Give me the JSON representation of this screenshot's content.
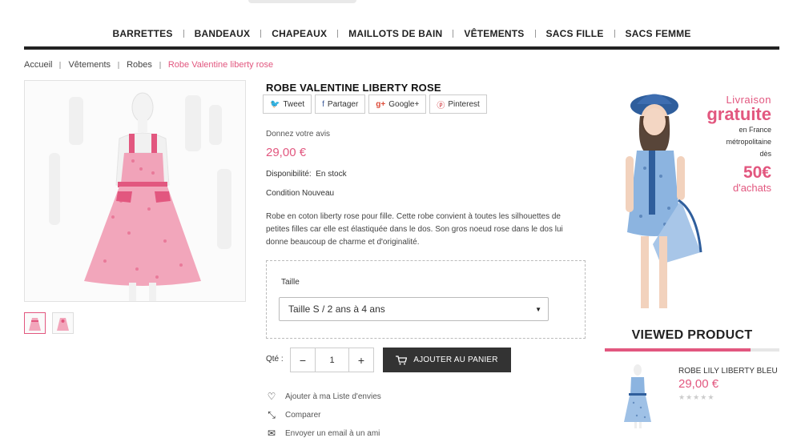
{
  "nav": {
    "items": [
      "BARRETTES",
      "BANDEAUX",
      "CHAPEAUX",
      "MAILLOTS DE BAIN",
      "VÊTEMENTS",
      "SACS FILLE",
      "SACS FEMME"
    ]
  },
  "breadcrumb": {
    "items": [
      "Accueil",
      "Vêtements",
      "Robes"
    ],
    "current": "Robe Valentine liberty rose"
  },
  "product": {
    "title": "ROBE VALENTINE LIBERTY ROSE",
    "share": {
      "tweet": "Tweet",
      "facebook": "Partager",
      "google": "Google+",
      "pinterest": "Pinterest"
    },
    "review_link": "Donnez votre avis",
    "price": "29,00 €",
    "availability_label": "Disponibilité:",
    "availability_value": "En stock",
    "condition_label": "Condition",
    "condition_value": "Nouveau",
    "description": "Robe en coton liberty rose pour fille. Cette robe convient à toutes les silhouettes de petites filles car elle est élastiquée dans le dos. Son gros noeud rose dans le dos lui donne beaucoup de charme et d'originalité.",
    "size_label": "Taille",
    "size_selected": "Taille S / 2 ans à 4 ans",
    "qty_label": "Qté :",
    "qty_value": "1",
    "qty_minus": "−",
    "qty_plus": "+",
    "add_to_cart": "AJOUTER AU PANIER",
    "wishlist": "Ajouter à ma Liste d'envies",
    "compare": "Comparer",
    "email_friend": "Envoyer un email à un ami"
  },
  "banner": {
    "line1": "Livraison",
    "line2": "gratuite",
    "line3": "en France",
    "line4": "métropolitaine",
    "line5": "dès",
    "line6": "50€",
    "line7": "d'achats"
  },
  "viewed": {
    "title": "VIEWED PRODUCT",
    "name": "ROBE LILY LIBERTY BLEU",
    "price": "29,00 €",
    "rating": 0
  },
  "colors": {
    "accent": "#e2577f",
    "dark": "#333333"
  }
}
